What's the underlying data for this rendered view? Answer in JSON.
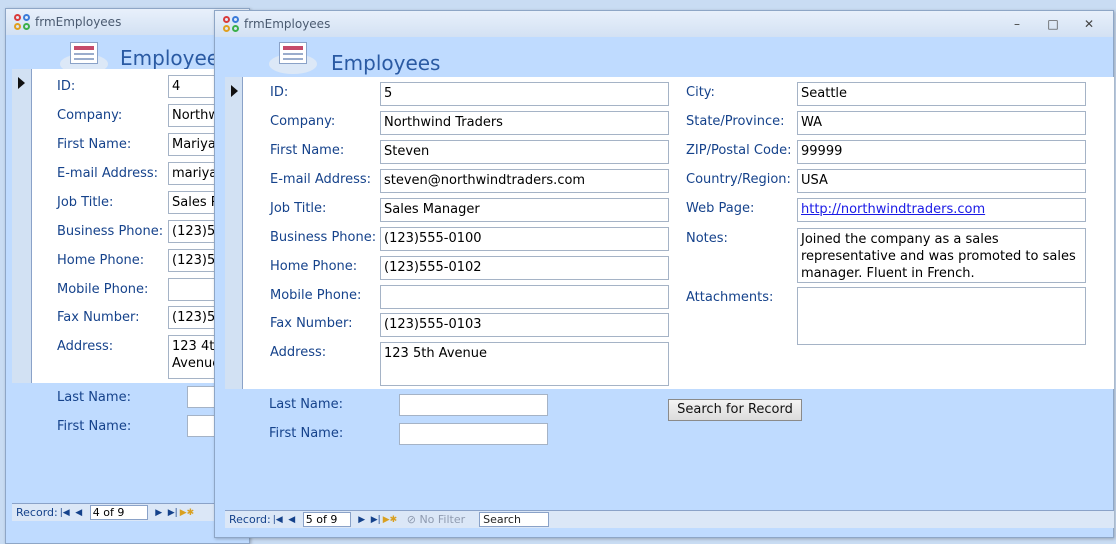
{
  "back_window": {
    "title": "frmEmployees",
    "form_title": "Employees",
    "labels": [
      "ID:",
      "Company:",
      "First Name:",
      "E-mail Address:",
      "Job Title:",
      "Business Phone:",
      "Home Phone:",
      "Mobile Phone:",
      "Fax Number:",
      "Address:"
    ],
    "values": [
      "4",
      "Northwind Traders",
      "Mariya",
      "mariya@northwindtraders.com",
      "Sales Representative",
      "(123)555-0100",
      "(123)555-0102",
      "",
      "(123)555-0103",
      "123 4th Avenue"
    ],
    "search": {
      "last_name_label": "Last Name:",
      "first_name_label": "First Name:"
    },
    "nav": {
      "record_label": "Record:",
      "position": "4 of 9"
    }
  },
  "front_window": {
    "title": "frmEmployees",
    "controls": {
      "minimize": "–",
      "maximize": "□",
      "close": "✕"
    },
    "form_title": "Employees",
    "left_fields": [
      {
        "label": "ID:",
        "value": "5"
      },
      {
        "label": "Company:",
        "value": "Northwind Traders"
      },
      {
        "label": "First Name:",
        "value": "Steven"
      },
      {
        "label": "E-mail Address:",
        "value": "steven@northwindtraders.com"
      },
      {
        "label": "Job Title:",
        "value": "Sales Manager"
      },
      {
        "label": "Business Phone:",
        "value": "(123)555-0100"
      },
      {
        "label": "Home Phone:",
        "value": "(123)555-0102"
      },
      {
        "label": "Mobile Phone:",
        "value": ""
      },
      {
        "label": "Fax Number:",
        "value": "(123)555-0103"
      },
      {
        "label": "Address:",
        "value": "123 5th Avenue"
      }
    ],
    "right_fields": [
      {
        "label": "City:",
        "value": "Seattle"
      },
      {
        "label": "State/Province:",
        "value": "WA"
      },
      {
        "label": "ZIP/Postal Code:",
        "value": "99999"
      },
      {
        "label": "Country/Region:",
        "value": "USA"
      },
      {
        "label": "Web Page:",
        "value": "http://northwindtraders.com"
      },
      {
        "label": "Notes:",
        "value": "Joined the company as a sales representative and was promoted to sales manager.  Fluent in French."
      },
      {
        "label": "Attachments:",
        "value": ""
      }
    ],
    "search": {
      "last_name_label": "Last Name:",
      "last_name_value": "",
      "first_name_label": "First Name:",
      "first_name_value": "",
      "button_label": "Search for Record"
    },
    "nav": {
      "record_label": "Record:",
      "position": "5 of 9",
      "filter_label": "No Filter",
      "search_label": "Search"
    }
  },
  "colors": {
    "label_text": "#15428b",
    "form_background": "#bfdbff",
    "link": "#1a1ae6"
  }
}
